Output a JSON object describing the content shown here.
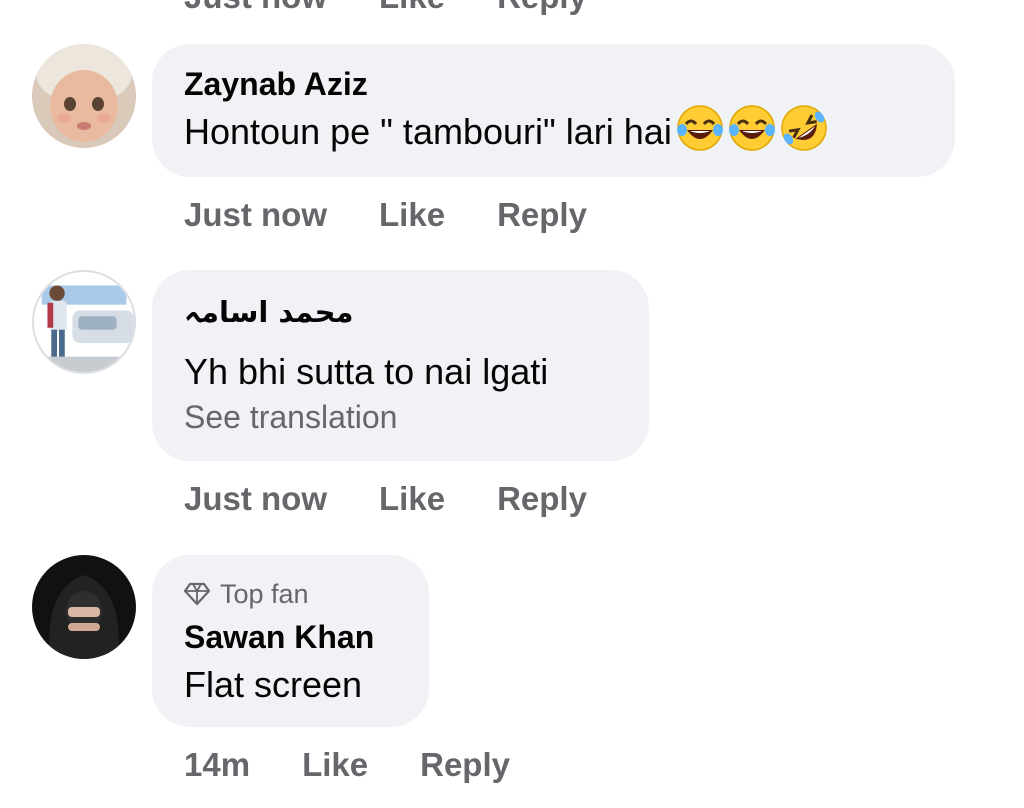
{
  "top_partial": {
    "time": "Just now",
    "like": "Like",
    "reply": "Reply"
  },
  "comments": [
    {
      "author": "Zaynab Aziz",
      "text": "Hontoun pe \" tambouri\" lari hai",
      "emojis": [
        "tears-of-joy-emoji",
        "tears-of-joy-emoji",
        "rolling-on-floor-laughing-emoji"
      ],
      "time": "Just now",
      "like": "Like",
      "reply": "Reply"
    },
    {
      "author": "محمد اسامہ",
      "text": "Yh bhi sutta to nai lgati",
      "see_translation": "See translation",
      "time": "Just now",
      "like": "Like",
      "reply": "Reply"
    },
    {
      "badge": "Top fan",
      "badge_icon": "diamond-icon",
      "author": "Sawan Khan",
      "text": "Flat screen",
      "time": "14m",
      "like": "Like",
      "reply": "Reply"
    }
  ],
  "colors": {
    "bubble": "#f0f2f5",
    "meta_text": "#65676b",
    "primary_text": "#050505",
    "emoji_yellow": "#ffcc33",
    "tear_blue": "#5ab4ff"
  }
}
